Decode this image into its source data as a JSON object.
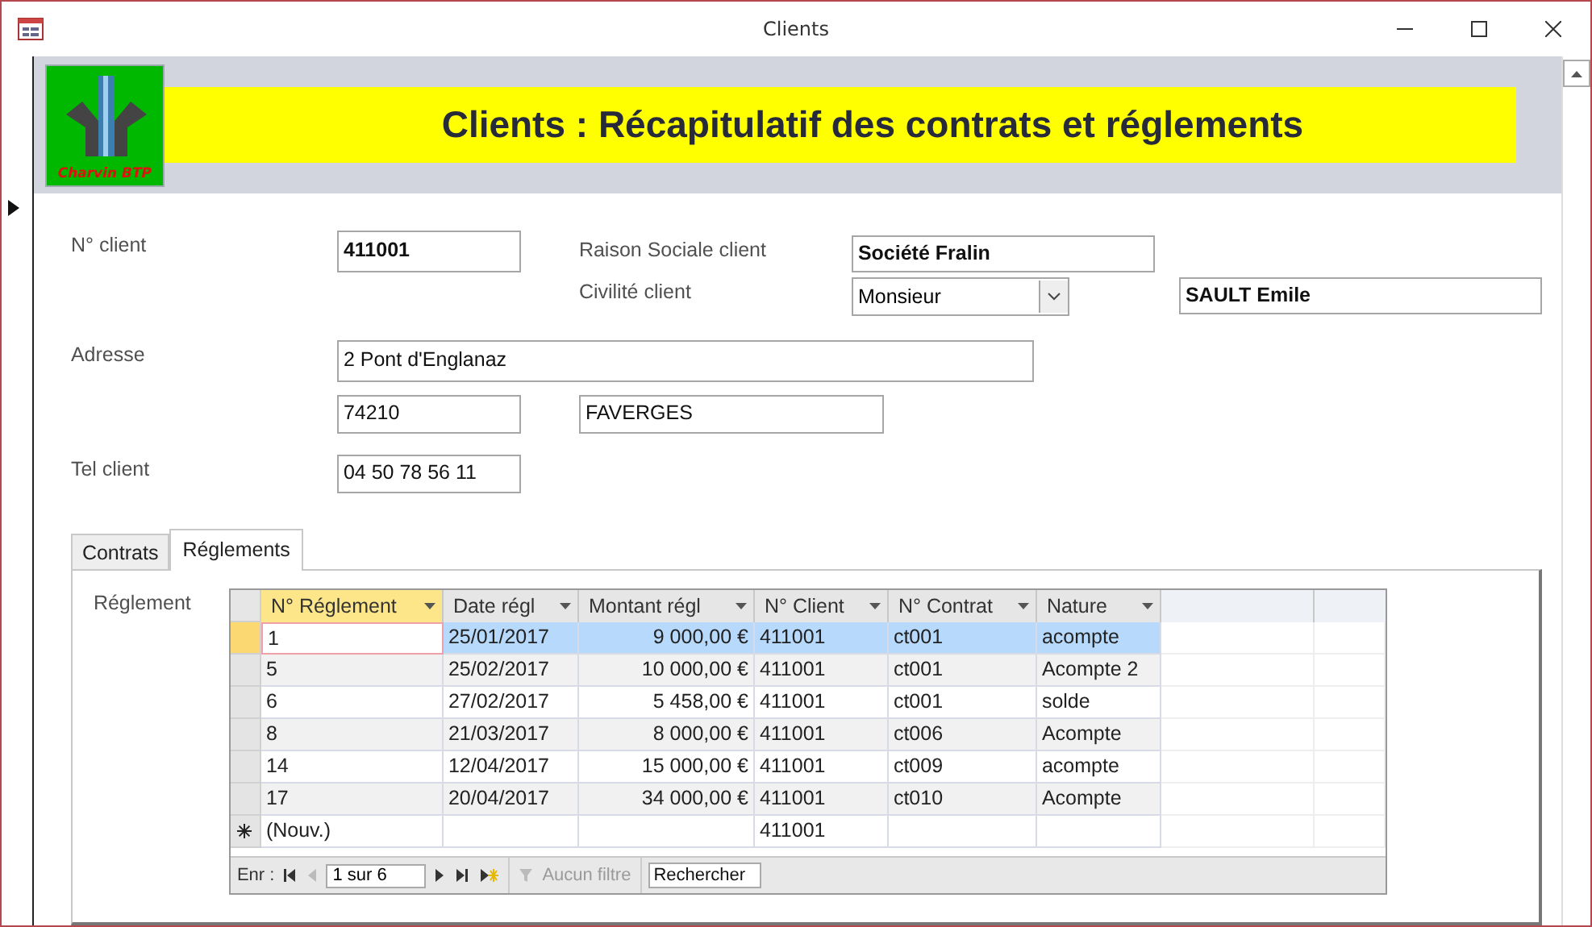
{
  "window": {
    "title": "Clients"
  },
  "header": {
    "logo_text": "Charvin BTP",
    "title": "Clients : Récapitulatif des contrats et réglements"
  },
  "form": {
    "client_no": {
      "label": "N° client",
      "value": "411001"
    },
    "company": {
      "label": "Raison Sociale  client",
      "value": "Société Fralin"
    },
    "civility": {
      "label": "Civilité client",
      "value": "Monsieur"
    },
    "contact": {
      "value": "SAULT Emile"
    },
    "address": {
      "label": "Adresse",
      "line": "2 Pont d'Englanaz",
      "postcode": "74210",
      "city": "FAVERGES"
    },
    "phone": {
      "label": "Tel client",
      "value": "04 50 78 56 11"
    }
  },
  "tabs": [
    {
      "label": "Contrats",
      "selected": false
    },
    {
      "label": "Réglements",
      "selected": true
    }
  ],
  "subform": {
    "label": "Réglement",
    "columns": [
      {
        "label": "N° Réglement",
        "selected": true,
        "kind": "text"
      },
      {
        "label": "Date régl",
        "selected": false,
        "kind": "text"
      },
      {
        "label": "Montant régl",
        "selected": false,
        "kind": "currency"
      },
      {
        "label": "N° Client",
        "selected": false,
        "kind": "text"
      },
      {
        "label": "N° Contrat",
        "selected": false,
        "kind": "text"
      },
      {
        "label": "Nature",
        "selected": false,
        "kind": "text"
      }
    ],
    "rows": [
      {
        "selected": true,
        "cells": [
          "1",
          "25/01/2017",
          "9 000,00 €",
          "411001",
          "ct001",
          "acompte"
        ]
      },
      {
        "selected": false,
        "cells": [
          "5",
          "25/02/2017",
          "10 000,00 €",
          "411001",
          "ct001",
          "Acompte 2"
        ]
      },
      {
        "selected": false,
        "cells": [
          "6",
          "27/02/2017",
          "5 458,00 €",
          "411001",
          "ct001",
          "solde"
        ]
      },
      {
        "selected": false,
        "cells": [
          "8",
          "21/03/2017",
          "8 000,00 €",
          "411001",
          "ct006",
          "Acompte"
        ]
      },
      {
        "selected": false,
        "cells": [
          "14",
          "12/04/2017",
          "15 000,00 €",
          "411001",
          "ct009",
          "acompte"
        ]
      },
      {
        "selected": false,
        "cells": [
          "17",
          "20/04/2017",
          "34 000,00 €",
          "411001",
          "ct010",
          "Acompte"
        ]
      }
    ],
    "new_row": {
      "first": "(Nouv.)",
      "client": "411001"
    },
    "navigation": {
      "label": "Enr :",
      "position": "1 sur 6",
      "filter": {
        "label": "Aucun filtre",
        "disabled": true
      },
      "search_placeholder": "Rechercher"
    }
  }
}
